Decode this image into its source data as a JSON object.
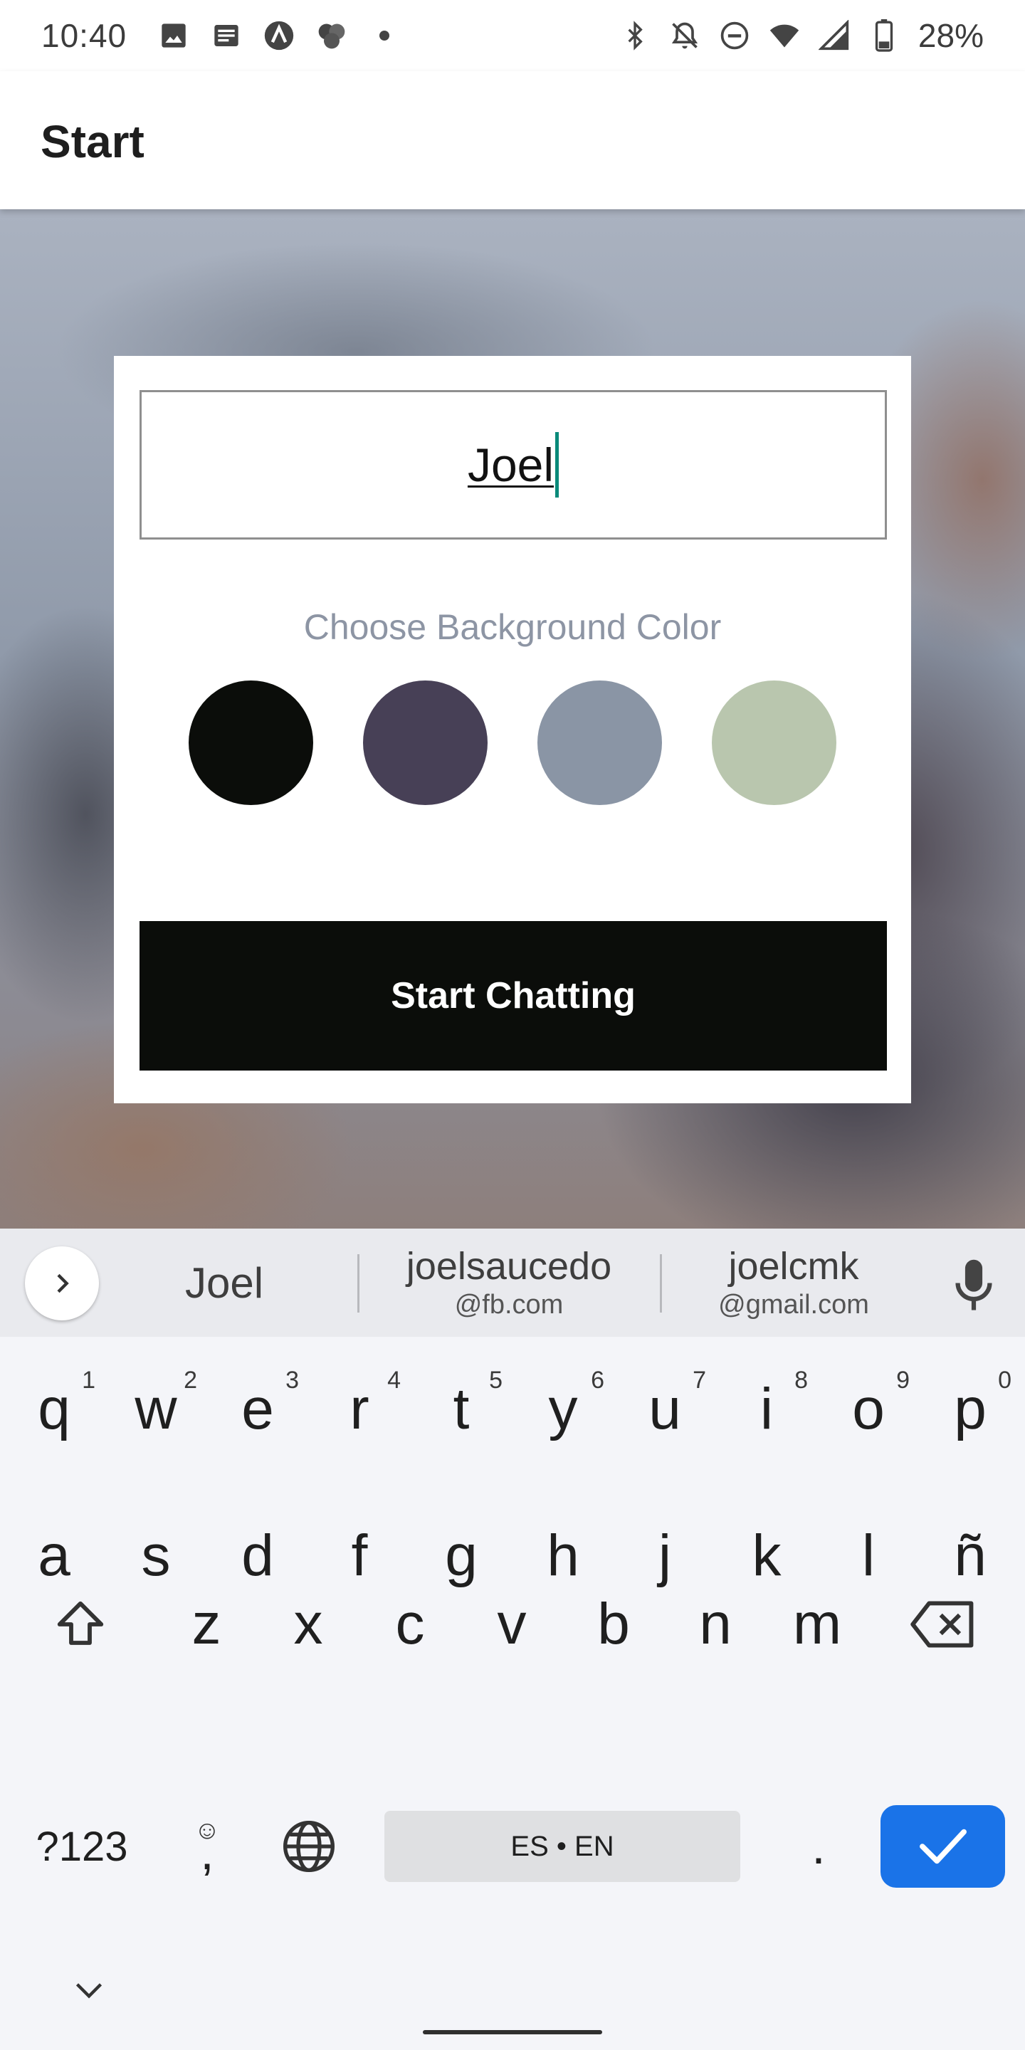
{
  "status_bar": {
    "time": "10:40",
    "left_icons": [
      "image-icon",
      "news-icon",
      "app-a-icon",
      "app-cluster-icon",
      "dot-icon"
    ],
    "right_icons": [
      "bluetooth-icon",
      "notifications-off-icon",
      "do-not-disturb-icon",
      "wifi-icon",
      "signal-icon",
      "battery-icon"
    ],
    "battery": "28%"
  },
  "app_bar": {
    "title": "Start"
  },
  "card": {
    "name_value": "Joel",
    "color_label": "Choose Background Color",
    "colors": [
      "#0b0d0a",
      "#474056",
      "#8a95a5",
      "#b9c6ae"
    ],
    "start_button": "Start Chatting"
  },
  "keyboard": {
    "suggestions": {
      "first": "Joel",
      "second": {
        "main": "joelsaucedo",
        "sub": "@fb.com"
      },
      "third": {
        "main": "joelcmk",
        "sub": "@gmail.com"
      }
    },
    "row1": [
      {
        "k": "q",
        "h": "1"
      },
      {
        "k": "w",
        "h": "2"
      },
      {
        "k": "e",
        "h": "3"
      },
      {
        "k": "r",
        "h": "4"
      },
      {
        "k": "t",
        "h": "5"
      },
      {
        "k": "y",
        "h": "6"
      },
      {
        "k": "u",
        "h": "7"
      },
      {
        "k": "i",
        "h": "8"
      },
      {
        "k": "o",
        "h": "9"
      },
      {
        "k": "p",
        "h": "0"
      }
    ],
    "row2": [
      "a",
      "s",
      "d",
      "f",
      "g",
      "h",
      "j",
      "k",
      "l",
      "ñ"
    ],
    "row3": [
      "z",
      "x",
      "c",
      "v",
      "b",
      "n",
      "m"
    ],
    "symbols_key": "?123",
    "comma_key": ",",
    "space_label": "ES • EN",
    "period_key": "."
  }
}
